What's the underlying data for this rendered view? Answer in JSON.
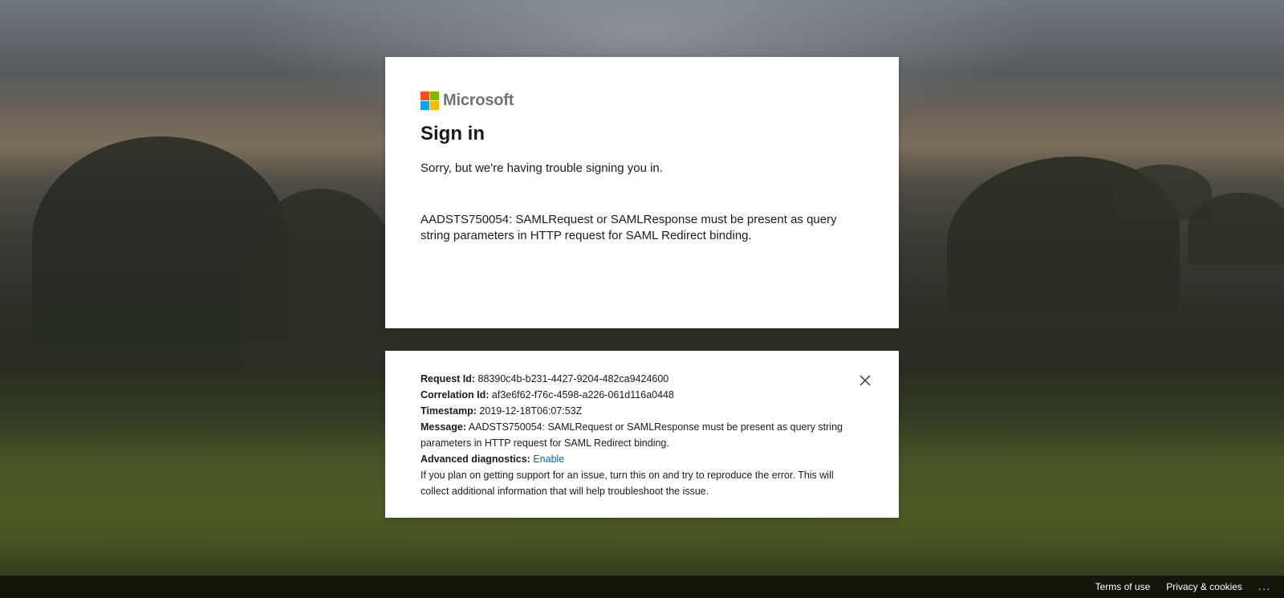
{
  "brand": {
    "name": "Microsoft",
    "logo_colors": [
      "#f25022",
      "#7fba00",
      "#00a4ef",
      "#ffb900"
    ]
  },
  "main": {
    "title": "Sign in",
    "subtitle": "Sorry, but we're having trouble signing you in.",
    "error": "AADSTS750054: SAMLRequest or SAMLResponse must be present as query string parameters in HTTP request for SAML Redirect binding."
  },
  "diagnostics": {
    "request_id_label": "Request Id:",
    "request_id": "88390c4b-b231-4427-9204-482ca9424600",
    "correlation_id_label": "Correlation Id:",
    "correlation_id": "af3e6f62-f76c-4598-a226-061d116a0448",
    "timestamp_label": "Timestamp:",
    "timestamp": "2019-12-18T06:07:53Z",
    "message_label": "Message:",
    "message": "AADSTS750054: SAMLRequest or SAMLResponse must be present as query string parameters in HTTP request for SAML Redirect binding.",
    "advanced_label": "Advanced diagnostics:",
    "advanced_link": "Enable",
    "help_text": "If you plan on getting support for an issue, turn this on and try to reproduce the error. This will collect additional information that will help troubleshoot the issue.",
    "close_icon": "close-icon",
    "link_color": "#0067b8"
  },
  "footer": {
    "terms": "Terms of use",
    "privacy": "Privacy & cookies",
    "more": "..."
  }
}
